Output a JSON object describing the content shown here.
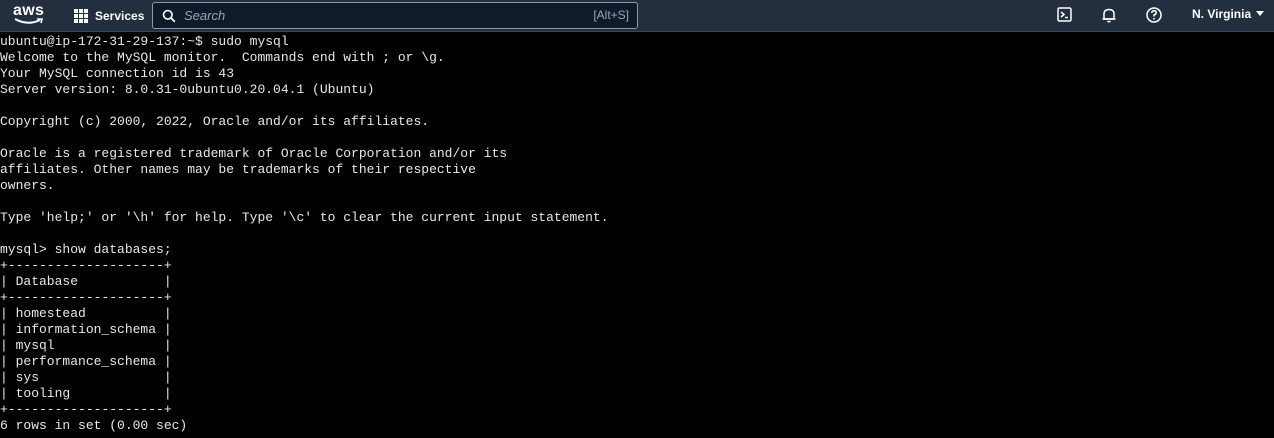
{
  "topbar": {
    "logo_text": "aws",
    "services_label": "Services",
    "search_placeholder": "Search",
    "search_shortcut": "[Alt+S]",
    "region_label": "N. Virginia",
    "icons": [
      "cloudshell-icon",
      "bell-icon",
      "help-icon",
      "caret-down-icon"
    ],
    "background_color": "#232f3e"
  },
  "terminal": {
    "background_color": "#000000",
    "text_color": "#e8e8e8",
    "lines": [
      "ubuntu@ip-172-31-29-137:~$ sudo mysql",
      "Welcome to the MySQL monitor.  Commands end with ; or \\g.",
      "Your MySQL connection id is 43",
      "Server version: 8.0.31-0ubuntu0.20.04.1 (Ubuntu)",
      "",
      "Copyright (c) 2000, 2022, Oracle and/or its affiliates.",
      "",
      "Oracle is a registered trademark of Oracle Corporation and/or its",
      "affiliates. Other names may be trademarks of their respective",
      "owners.",
      "",
      "Type 'help;' or '\\h' for help. Type '\\c' to clear the current input statement.",
      "",
      "mysql> show databases;",
      "+--------------------+",
      "| Database           |",
      "+--------------------+",
      "| homestead          |",
      "| information_schema |",
      "| mysql              |",
      "| performance_schema |",
      "| sys                |",
      "| tooling            |",
      "+--------------------+",
      "6 rows in set (0.00 sec)"
    ]
  }
}
